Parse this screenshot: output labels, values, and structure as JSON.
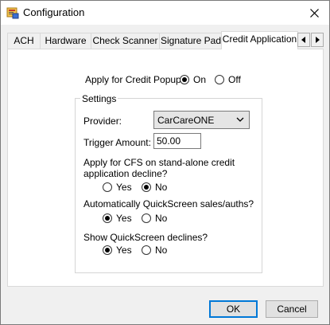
{
  "window": {
    "title": "Configuration",
    "icon": "app-config-icon",
    "close_icon": "close-icon"
  },
  "tabs": [
    {
      "label": "ACH"
    },
    {
      "label": "Hardware"
    },
    {
      "label": "Check Scanner"
    },
    {
      "label": "Signature Pad"
    },
    {
      "label": "Credit Application",
      "active": true
    }
  ],
  "tab_scroll": {
    "left_icon": "arrow-left-icon",
    "right_icon": "arrow-right-icon"
  },
  "popup": {
    "label": "Apply for Credit Popup:",
    "on_label": "On",
    "off_label": "Off",
    "selected": "On"
  },
  "settings": {
    "legend": "Settings",
    "provider_label": "Provider:",
    "provider_value": "CarCareONE",
    "trigger_label": "Trigger Amount:",
    "trigger_value": "50.00",
    "cfs_question_line1": "Apply for CFS on stand-alone credit",
    "cfs_question_line2": "application decline?",
    "cfs_yes": "Yes",
    "cfs_no": "No",
    "cfs_selected": "No",
    "quickscreen_question": "Automatically QuickScreen sales/auths?",
    "quickscreen_yes": "Yes",
    "quickscreen_no": "No",
    "quickscreen_selected": "Yes",
    "declines_question": "Show QuickScreen declines?",
    "declines_yes": "Yes",
    "declines_no": "No",
    "declines_selected": "Yes"
  },
  "buttons": {
    "ok": "OK",
    "cancel": "Cancel"
  }
}
